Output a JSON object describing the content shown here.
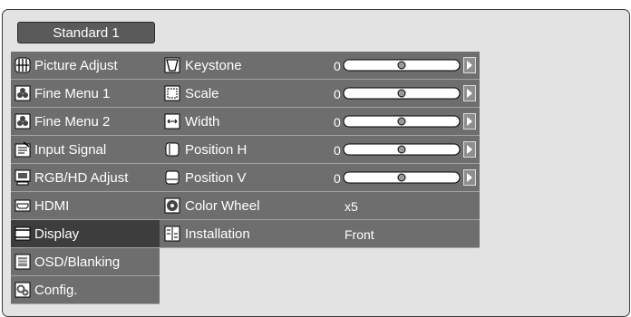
{
  "preset": {
    "label": "Standard 1"
  },
  "menu": {
    "items": [
      {
        "label": "Picture Adjust",
        "icon": "picture-adjust-icon"
      },
      {
        "label": "Fine Menu 1",
        "icon": "fine-menu-1-icon"
      },
      {
        "label": "Fine Menu 2",
        "icon": "fine-menu-2-icon"
      },
      {
        "label": "Input Signal",
        "icon": "input-signal-icon"
      },
      {
        "label": "RGB/HD Adjust",
        "icon": "rgb-hd-adjust-icon"
      },
      {
        "label": "HDMI",
        "icon": "hdmi-icon"
      },
      {
        "label": "Display",
        "icon": "display-icon",
        "selected": true
      },
      {
        "label": "OSD/Blanking",
        "icon": "osd-blanking-icon"
      },
      {
        "label": "Config.",
        "icon": "config-icon"
      }
    ]
  },
  "display": {
    "rows": [
      {
        "label": "Keystone",
        "value": "0",
        "slider_level": 0.5,
        "icon": "keystone-icon"
      },
      {
        "label": "Scale",
        "value": "0",
        "slider_level": 0.5,
        "icon": "scale-icon"
      },
      {
        "label": "Width",
        "value": "0",
        "slider_level": 0.5,
        "icon": "width-icon"
      },
      {
        "label": "Position H",
        "value": "0",
        "slider_level": 0.5,
        "icon": "position-h-icon"
      },
      {
        "label": "Position V",
        "value": "0",
        "slider_level": 0.5,
        "icon": "position-v-icon"
      },
      {
        "label": "Color Wheel",
        "value": "x5",
        "icon": "color-wheel-icon"
      },
      {
        "label": "Installation",
        "value": "Front",
        "icon": "installation-icon"
      }
    ]
  },
  "colors": {
    "frame_bg": "#e3e3e3",
    "item_bg": "#6e6e6e",
    "selected_bg": "#3d3d3d",
    "text": "#ffffff"
  }
}
